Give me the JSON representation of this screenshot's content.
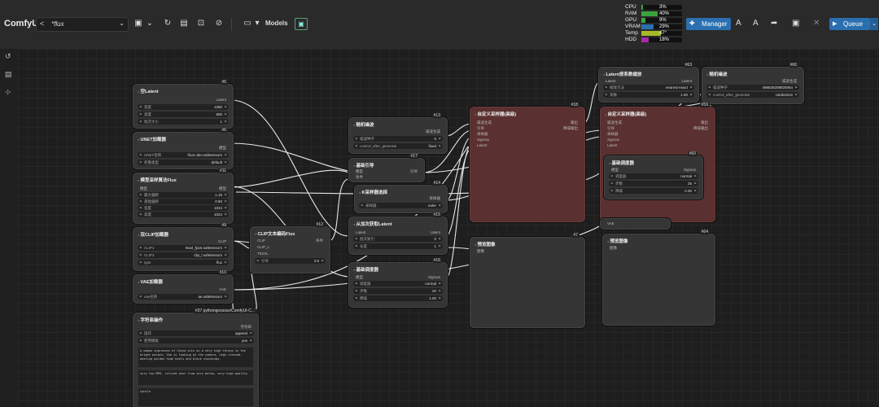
{
  "app": {
    "brand": "ComfyUI",
    "workflow_name": "*flux"
  },
  "toolbar": {
    "models_label": "Models"
  },
  "stats": [
    {
      "label": "CPU",
      "value": "3%",
      "pct": 3,
      "color": "#3aa33a"
    },
    {
      "label": "RAM",
      "value": "40%",
      "pct": 40,
      "color": "#3aa33a"
    },
    {
      "label": "GPU",
      "value": "9%",
      "pct": 9,
      "color": "#3aa33a"
    },
    {
      "label": "VRAM",
      "value": "29%",
      "pct": 29,
      "color": "#2a6fb0"
    },
    {
      "label": "Temp",
      "value": "47°",
      "pct": 47,
      "color": "#a5b82a"
    },
    {
      "label": "HDD",
      "value": "18%",
      "pct": 18,
      "color": "#a52aa5"
    }
  ],
  "buttons": {
    "manager": "Manager",
    "queue": "Queue"
  },
  "nodes": {
    "empty_latent": {
      "id": "#5",
      "title": "空Latent",
      "out": "Latent",
      "w": [
        [
          "宽度",
          "1280"
        ],
        [
          "高度",
          "800"
        ],
        [
          "批次大小",
          "1"
        ]
      ]
    },
    "unet": {
      "id": "#6",
      "title": "UNET加载器",
      "out": "模型",
      "w": [
        [
          "UNET名称",
          "flux1-dev.safetensors"
        ],
        [
          "权重类型",
          "default"
        ]
      ]
    },
    "sampling_flux": {
      "id": "#11",
      "title": "模型采样算法Flux",
      "in": "模型",
      "out": "模型",
      "w": [
        [
          "最大偏移",
          "1.15"
        ],
        [
          "基础偏移",
          "0.50"
        ],
        [
          "宽度",
          "1024"
        ],
        [
          "高度",
          "1024"
        ]
      ]
    },
    "dual_clip": {
      "id": "#9",
      "title": "双CLIP加载器",
      "out": "CLIP",
      "w": [
        [
          "CLIP1",
          "t5xxl_fp16.safetensors"
        ],
        [
          "CLIP2",
          "clip_l.safetensors"
        ],
        [
          "type",
          "flux"
        ]
      ]
    },
    "vae": {
      "id": "#10",
      "title": "VAE加载器",
      "out": "VAE",
      "w": [
        [
          "vae名称",
          "ae.safetensors"
        ]
      ]
    },
    "string_op": {
      "id": "#37 pythongosssss/ComfyUI-C...",
      "title": "字符串操作",
      "out": "字符串",
      "w": [
        [
          "操作",
          "append"
        ],
        [
          "使用模板",
          "yes"
        ]
      ],
      "text1": "A woman engrosses of China sits on a very high throne in the bright palace, She is looking at the camera, legs crossed, wearing golden high heels and black stockings.",
      "text2": "very low MPR, (sliced dust from very below, very high quality",
      "text3": "Lphile"
    },
    "clip_text": {
      "id": "#12",
      "title": "CLIP文本编码Flux",
      "ins": [
        "CLIP",
        "CLIP_L",
        "T5XXL"
      ],
      "out": "条件",
      "w": [
        [
          "引导",
          "3.5"
        ]
      ]
    },
    "random_noise": {
      "id": "#13",
      "title": "随机噪波",
      "out": "噪波生成",
      "w": [
        [
          "噪波种子",
          "5"
        ],
        [
          "control_after_generate",
          "fixed"
        ]
      ]
    },
    "basic_guider": {
      "id": "#17",
      "title": "基础引导",
      "ins": [
        "模型",
        "条件"
      ],
      "out": "引导"
    },
    "ksampler_select": {
      "id": "#14",
      "title": "K采样器选择",
      "out": "采样器",
      "w": [
        [
          "采样器",
          "euler"
        ]
      ]
    },
    "split_sigma": {
      "id": "#15",
      "title": "从加次获取Latent",
      "ins": [
        "Latent"
      ],
      "outs": [
        "Latent",
        "Latent"
      ],
      "w": [
        [
          "批次索引",
          "0"
        ],
        [
          "长度",
          "1"
        ]
      ]
    },
    "basic_scheduler": {
      "id": "#16",
      "title": "基础调度器",
      "in": "模型",
      "out": "Sigmas",
      "w": [
        [
          "调度器",
          "normal"
        ],
        [
          "步数",
          "20"
        ],
        [
          "降噪",
          "1.00"
        ]
      ]
    },
    "custom_sampler": {
      "id": "#18",
      "title": "自定义采样器(高级)",
      "ins": [
        "噪波生成",
        "引导",
        "采样器",
        "Sigmas",
        "Latent"
      ],
      "outs": [
        "输出",
        "降噪输出"
      ]
    },
    "preview1": {
      "id": "#7",
      "title": "预览图像",
      "in": "图像"
    },
    "latent_upscale": {
      "id": "#63",
      "title": "Latent按系数缩放",
      "in": "Latent",
      "out": "Latent",
      "w": [
        [
          "缩放方法",
          "nearest-exact"
        ],
        [
          "系数",
          "1.50"
        ]
      ]
    },
    "random_noise2": {
      "id": "#66",
      "title": "随机噪波",
      "out": "噪波生成",
      "w": [
        [
          "噪波种子",
          "496828208820064"
        ],
        [
          "control_after_generate",
          "randomize"
        ]
      ]
    },
    "custom_sampler2": {
      "id": "#59",
      "title": "自定义采样器(高级)",
      "ins": [
        "噪波生成",
        "引导",
        "采样器",
        "Sigmas",
        "Latent"
      ],
      "outs": [
        "输出",
        "降噪输出"
      ]
    },
    "basic_scheduler2": {
      "id": "#60",
      "title": "基础调度器",
      "in": "模型",
      "out": "Sigmas",
      "w": [
        [
          "调度器",
          "normal"
        ],
        [
          "步数",
          "25"
        ],
        [
          "降噪",
          "0.30"
        ]
      ]
    },
    "preview2": {
      "id": "#64",
      "title": "预览图像",
      "in": "图像"
    },
    "vae_decode_label": "VAE"
  }
}
